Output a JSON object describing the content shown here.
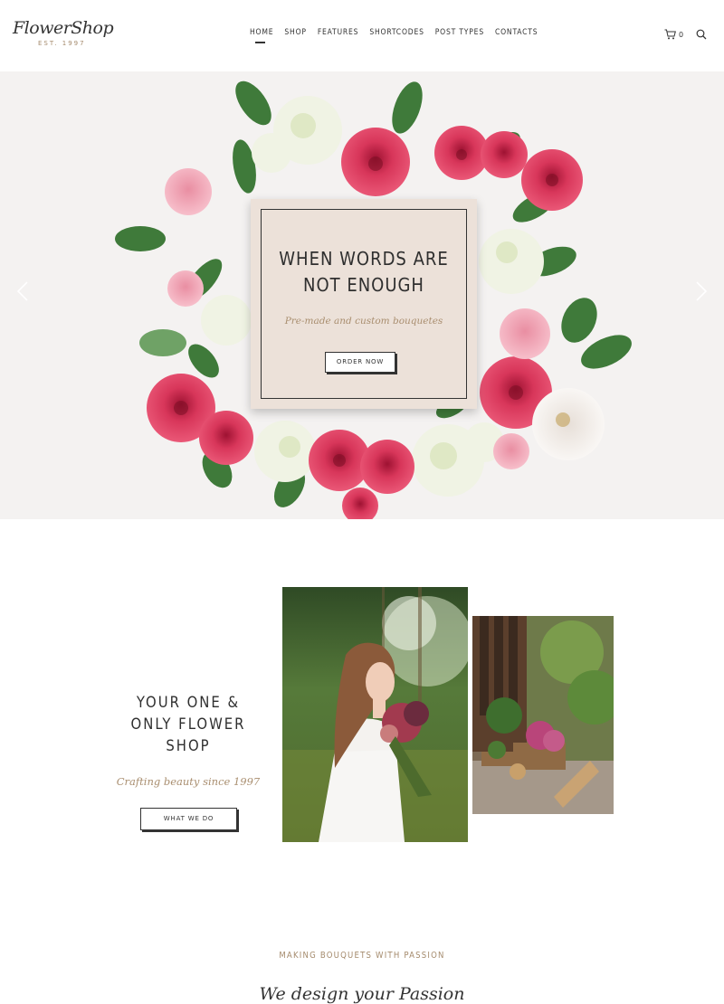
{
  "brand": {
    "name": "FlowerShop",
    "tagline": "EST. 1997"
  },
  "nav": {
    "items": [
      {
        "label": "HOME",
        "active": true
      },
      {
        "label": "SHOP"
      },
      {
        "label": "FEATURES"
      },
      {
        "label": "SHORTCODES"
      },
      {
        "label": "POST TYPES"
      },
      {
        "label": "CONTACTS"
      }
    ]
  },
  "cart": {
    "count": "0",
    "icon": "cart-icon"
  },
  "search": {
    "icon": "search-icon"
  },
  "hero": {
    "title_line1": "WHEN WORDS ARE",
    "title_line2": "NOT ENOUGH",
    "subtitle": "Pre-made and custom bouquetes",
    "button": "ORDER NOW"
  },
  "about": {
    "title_line1": "YOUR ONE &",
    "title_line2": "ONLY FLOWER",
    "title_line3": "SHOP",
    "subtitle": "Crafting beauty since 1997",
    "button": "WHAT WE DO"
  },
  "passion": {
    "heading": "MAKING BOUQUETS WITH PASSION",
    "script": "We design your Passion"
  },
  "colors": {
    "accent": "#a98e6f",
    "dark": "#2f2f2f",
    "rose": "#d8365a"
  }
}
